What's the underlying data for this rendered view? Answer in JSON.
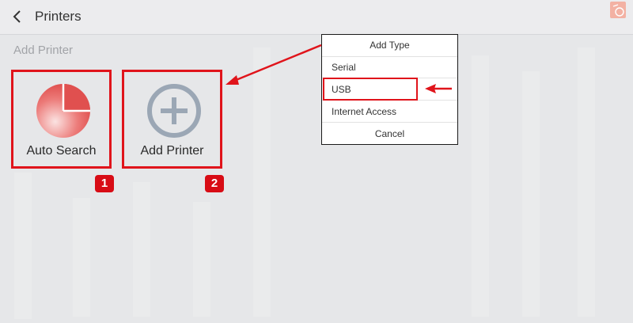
{
  "header": {
    "title": "Printers",
    "back_icon": "chevron-left-icon",
    "logo_icon": "app-logo-icon"
  },
  "section": {
    "label": "Add Printer"
  },
  "tiles": [
    {
      "label": "Auto Search",
      "icon": "radar-search-icon",
      "badge": "1"
    },
    {
      "label": "Add Printer",
      "icon": "plus-circle-icon",
      "badge": "2"
    }
  ],
  "dialog": {
    "title": "Add Type",
    "options": [
      "Serial",
      "USB",
      "Internet Access"
    ],
    "cancel_label": "Cancel",
    "highlighted_option": "USB"
  },
  "colors": {
    "accent_red": "#e0141b",
    "badge_red": "#d80c15",
    "icon_red": "#e0504f",
    "icon_gray": "#9ba7b5"
  }
}
